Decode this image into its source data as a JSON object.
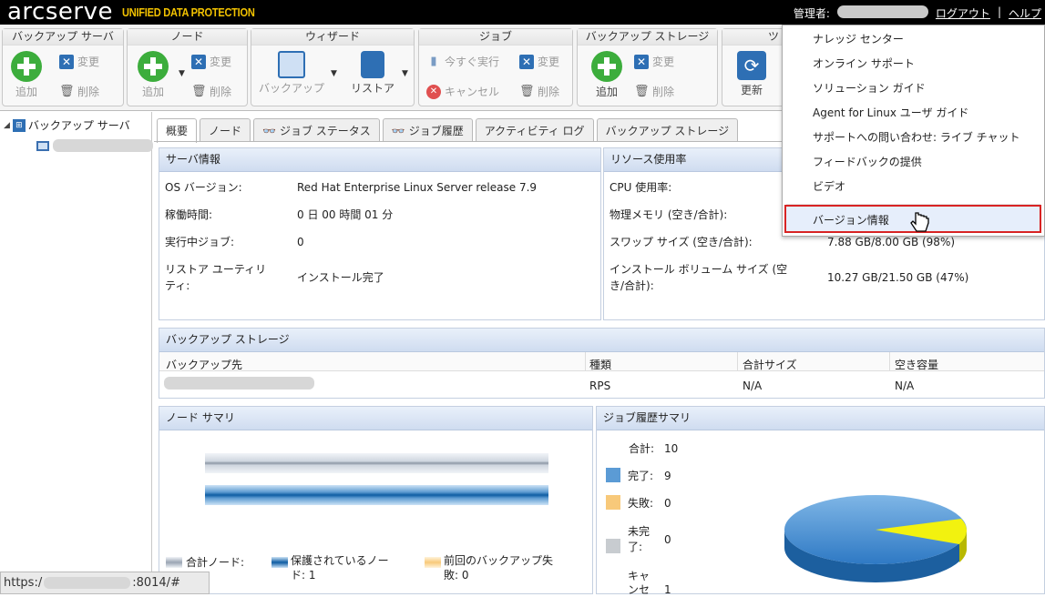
{
  "header": {
    "logo": "arcserve",
    "logo_sub": "UNIFIED DATA PROTECTION",
    "admin_label": "管理者:",
    "logout": "ログアウト",
    "separator": "|",
    "help": "ヘルプ"
  },
  "toolbar": {
    "backup_server": {
      "title": "バックアップ サーバ",
      "add": "追加",
      "change": "変更",
      "delete": "削除"
    },
    "node": {
      "title": "ノード",
      "add": "追加",
      "change": "変更",
      "delete": "削除"
    },
    "wizard": {
      "title": "ウィザード",
      "backup": "バックアップ",
      "restore": "リストア"
    },
    "job": {
      "title": "ジョブ",
      "run_now": "今すぐ実行",
      "change": "変更",
      "cancel": "キャンセル",
      "delete": "削除"
    },
    "backup_storage": {
      "title": "バックアップ ストレージ",
      "add": "追加",
      "change": "変更",
      "delete": "削除"
    },
    "tools": {
      "title": "ツ",
      "refresh": "更新"
    }
  },
  "help_menu": {
    "items": [
      "ナレッジ センター",
      "オンライン サポート",
      "ソリューション ガイド",
      "Agent for Linux ユーザ ガイド",
      "サポートへの問い合わせ: ライブ チャット",
      "フィードバックの提供",
      "ビデオ"
    ],
    "version_info": "バージョン情報"
  },
  "tree": {
    "root": "バックアップ サーバ"
  },
  "tabs": [
    "概要",
    "ノード",
    "ジョブ ステータス",
    "ジョブ履歴",
    "アクティビティ ログ",
    "バックアップ ストレージ"
  ],
  "server_info": {
    "title": "サーバ情報",
    "os_label": "OS バージョン:",
    "os_value": "Red Hat Enterprise Linux Server release 7.9",
    "uptime_label": "稼働時間:",
    "uptime_value": "0 日 00 時間 01 分",
    "running_label": "実行中ジョブ:",
    "running_value": "0",
    "restore_label_1": "リストア ユーティリ",
    "restore_label_2": "ティ:",
    "restore_value": "インストール完了"
  },
  "resource": {
    "title": "リソース使用率",
    "cpu_label": "CPU 使用率:",
    "mem_label": "物理メモリ (空き/合計):",
    "swap_label": "スワップ サイズ (空き/合計):",
    "swap_value": "7.88 GB/8.00 GB (98%)",
    "vol_label_1": "インストール ボリューム サイズ (空",
    "vol_label_2": "き/合計):",
    "vol_value": "10.27 GB/21.50 GB (47%)"
  },
  "storage": {
    "title": "バックアップ ストレージ",
    "columns": [
      "バックアップ先",
      "種類",
      "合計サイズ",
      "空き容量"
    ],
    "row": {
      "type": "RPS",
      "total": "N/A",
      "free": "N/A"
    }
  },
  "node_summary": {
    "title": "ノード サマリ",
    "legend_total": "合計ノード:",
    "legend_protected_1": "保護されているノー",
    "legend_protected_2": "ド: 1",
    "legend_failed_1": "前回のバックアップ失",
    "legend_failed_2": "敗: 0"
  },
  "job_summary": {
    "title": "ジョブ履歴サマリ",
    "total_label": "合計:",
    "total_value": "10",
    "done_label": "完了:",
    "done_value": "9",
    "fail_label": "失敗:",
    "fail_value": "0",
    "incomplete_label_1": "未完",
    "incomplete_label_2": "了:",
    "incomplete_value": "0",
    "cancel_label_1": "キャ",
    "cancel_label_2": "ンセ",
    "cancel_value": "1",
    "colors": {
      "done": "#5b9bd5",
      "fail": "#f8c97a",
      "incomplete": "#c8ccd0",
      "cancel": "#f2f20f"
    }
  },
  "statusbar": {
    "prefix": "https:/",
    "suffix": ":8014/#"
  }
}
